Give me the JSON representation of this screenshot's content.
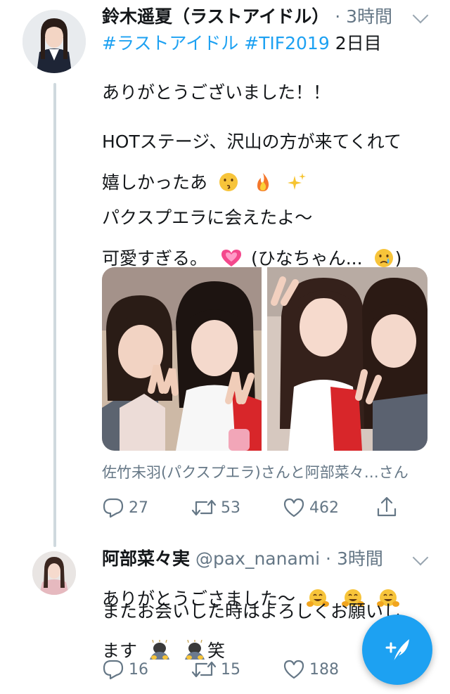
{
  "tweet1": {
    "name": "鈴木遥夏（ラストアイドル）",
    "separator": "·",
    "time": "3時間",
    "line1_tags": "#ラストアイドル #TIF2019",
    "line1_rest": " 2日目",
    "line2": "ありがとうございました！！",
    "line3": "HOTステージ、沢山の方が来てくれて",
    "line4": "嬉しかったあ",
    "line5": "パクスプエラに会えたよ〜",
    "line6a": "可愛すぎる。",
    "line6b": " (ひなちゃん...",
    "line6c": ")",
    "tagged": "佐竹未羽(パクスプエラ)さんと阿部菜々…さん",
    "replies": "27",
    "retweets": "53",
    "likes": "462"
  },
  "tweet2": {
    "name": "阿部菜々実",
    "handle": "@pax_nanami",
    "separator": "·",
    "time": "3時間",
    "line1": "ありがとうごさました〜",
    "line2": "またお会いした時はよろしくお願いし",
    "line3a": "ます",
    "line3b": "笑",
    "replies": "16",
    "retweets": "15",
    "likes": "188"
  },
  "icons": {
    "caret": "chevron-down-icon",
    "reply": "reply-icon",
    "retweet": "retweet-icon",
    "like": "heart-icon",
    "share": "share-icon",
    "compose": "compose-tweet-icon"
  },
  "colors": {
    "link": "#1da1f2",
    "muted": "#657786",
    "thread": "#cfd9de"
  }
}
